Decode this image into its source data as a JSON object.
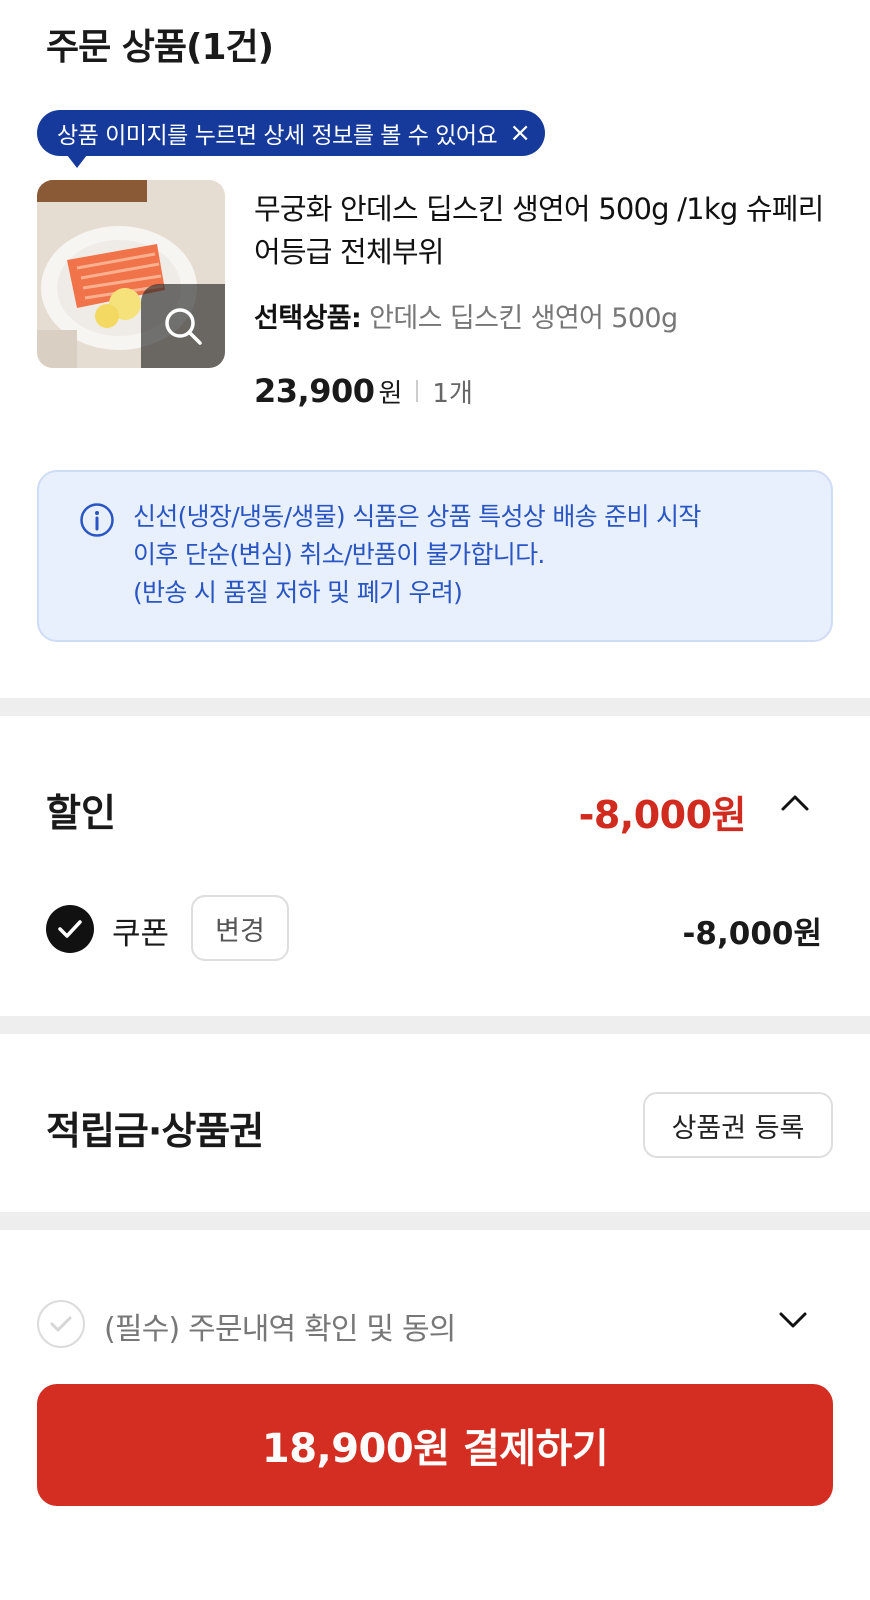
{
  "order": {
    "section_title": "주문 상품(1건)"
  },
  "tooltip": {
    "text": "상품 이미지를 누르면 상세 정보를 볼 수 있어요",
    "close_glyph": "×"
  },
  "product": {
    "name": "무궁화 안데스 딥스킨 생연어 500g /1kg 슈페리어등급 전체부위",
    "option_label": "선택상품:",
    "option_value": "안데스 딥스킨 생연어 500g",
    "price": "23,900",
    "currency": "원",
    "quantity": "1개",
    "image_icon": "magnifier-icon"
  },
  "notice": {
    "icon": "info-icon",
    "line1": "신선(냉장/냉동/생물) 식품은 상품 특성상 배송 준비 시작",
    "line2": "이후 단순(변심) 취소/반품이 불가합니다.",
    "line3": "(반송 시 품질 저하 및 폐기 우려)"
  },
  "discount": {
    "title": "할인",
    "total": "-8,000원",
    "coupon_label": "쿠폰",
    "change_label": "변경",
    "coupon_amount": "-8,000원"
  },
  "points": {
    "title": "적립금·상품권",
    "register_voucher_label": "상품권 등록"
  },
  "agreement": {
    "text": "(필수) 주문내역 확인 및 동의"
  },
  "payment": {
    "button_label": "18,900원 결제하기"
  },
  "colors": {
    "accent_red": "#d42e22",
    "discount_red": "#d12a1f",
    "tooltip_blue": "#163a9c",
    "notice_text_blue": "#2a56c4",
    "notice_bg": "#e8f0fd"
  }
}
